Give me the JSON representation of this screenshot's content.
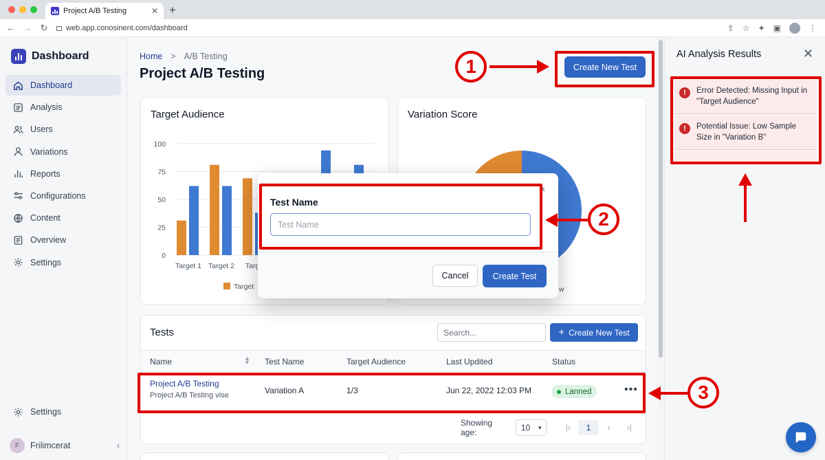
{
  "browser": {
    "tab_title": "Project A/B Testing",
    "url": "web.app.conosinent.com/dashboard"
  },
  "sidebar": {
    "brand": "Dashboard",
    "items": [
      {
        "label": "Dashboard",
        "icon": "home-icon",
        "active": true
      },
      {
        "label": "Analysis",
        "icon": "list-icon"
      },
      {
        "label": "Users",
        "icon": "users-icon"
      },
      {
        "label": "Variations",
        "icon": "user-icon"
      },
      {
        "label": "Reports",
        "icon": "bar-chart-icon"
      },
      {
        "label": "Configurations",
        "icon": "sliders-icon"
      },
      {
        "label": "Content",
        "icon": "globe-icon"
      },
      {
        "label": "Overview",
        "icon": "document-icon"
      },
      {
        "label": "Settings",
        "icon": "gear-icon"
      }
    ],
    "bottom_settings": "Settings",
    "user_name": "Frilimcerat"
  },
  "header": {
    "breadcrumb_home": "Home",
    "breadcrumb_sep": ">",
    "breadcrumb_current": "A/B Testing",
    "title": "Project A/B Testing",
    "create_button": "Create New Test"
  },
  "cards": {
    "target_title": "Target Audience",
    "variation_title": "Variation Score"
  },
  "chart_data": [
    {
      "type": "bar",
      "title": "Target Audience",
      "categories": [
        "Target 1",
        "Target 2",
        "Targe",
        "",
        "",
        ""
      ],
      "series": [
        {
          "name": "Target",
          "color": "#e08a32",
          "values": [
            31,
            81,
            69,
            null,
            null,
            null
          ]
        },
        {
          "color": "#3f79d1",
          "values": [
            62,
            62,
            38,
            null,
            94,
            81
          ]
        }
      ],
      "yticks": [
        0,
        25,
        50,
        75,
        100
      ],
      "ylim": [
        0,
        100
      ],
      "legend": "bottom"
    },
    {
      "type": "pie",
      "title": "Variation Score",
      "legend_partial": "w",
      "slices": [
        {
          "color": "#3f79d1",
          "value": 60
        },
        {
          "color": "#e08a32",
          "value": 40
        }
      ]
    }
  ],
  "modal": {
    "label": "Test Name",
    "placeholder": "Test Name",
    "cancel": "Cancel",
    "create": "Create Test",
    "close": "×"
  },
  "tests": {
    "title": "Tests",
    "search_placeholder": "Search...",
    "create_button": "Create New Test",
    "columns": [
      "Name",
      "Test Name",
      "Target Audience",
      "Last Updited",
      "Status"
    ],
    "rows": [
      {
        "name": "Project A/B Testing",
        "subtitle": "Project A/B Testing vise",
        "test_name": "Variation A",
        "audience": "1/3",
        "updated": "Jun 22, 2022 12:03 PM",
        "status": "Lanned",
        "status_color": "#16a34a"
      }
    ],
    "pager_label": "Showing age:",
    "page_size": "10",
    "current_page": "1"
  },
  "analysis": {
    "title": "AI Analysis Results",
    "alerts": [
      {
        "text": "Error Detected: Missing Input in \"Target Audience\""
      },
      {
        "text": "Potential Issue: Low Sample Size in \"Variation B\""
      }
    ]
  },
  "annotations": {
    "callouts": [
      "1",
      "2",
      "3"
    ],
    "highlight_color": "#e00000"
  }
}
